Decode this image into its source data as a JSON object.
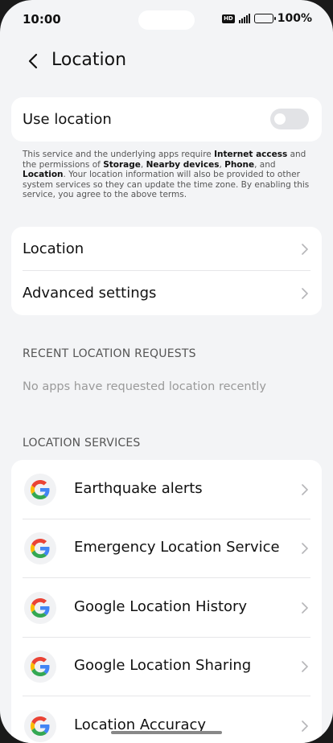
{
  "status_bar": {
    "time": "10:00",
    "hd": "HD",
    "battery": "100%"
  },
  "header": {
    "title": "Location"
  },
  "use_location": {
    "label": "Use location",
    "enabled": false
  },
  "description": {
    "p1": "This service and the underlying apps require ",
    "b1": "Internet access",
    "p2": " and the permissions of ",
    "b2": "Storage",
    "p3": ", ",
    "b3": "Nearby devices",
    "p4": ", ",
    "b4": "Phone",
    "p5": ", and ",
    "b5": "Location",
    "p6": ". Your location information will also be provided to other system services so they can update the time zone. By enabling this service, you agree to the above terms."
  },
  "settings": {
    "items": [
      {
        "label": "Location"
      },
      {
        "label": "Advanced settings"
      }
    ]
  },
  "recent": {
    "title": "RECENT LOCATION REQUESTS",
    "empty": "No apps have requested location recently"
  },
  "services": {
    "title": "LOCATION SERVICES",
    "items": [
      {
        "label": "Earthquake alerts"
      },
      {
        "label": "Emergency Location Service"
      },
      {
        "label": "Google Location History"
      },
      {
        "label": "Google Location Sharing"
      },
      {
        "label": "Location Accuracy"
      }
    ]
  },
  "colors": {
    "background": "#f3f4f6",
    "card": "#ffffff",
    "google_blue": "#4285F4",
    "google_red": "#EA4335",
    "google_yellow": "#FBBC05",
    "google_green": "#34A853"
  }
}
